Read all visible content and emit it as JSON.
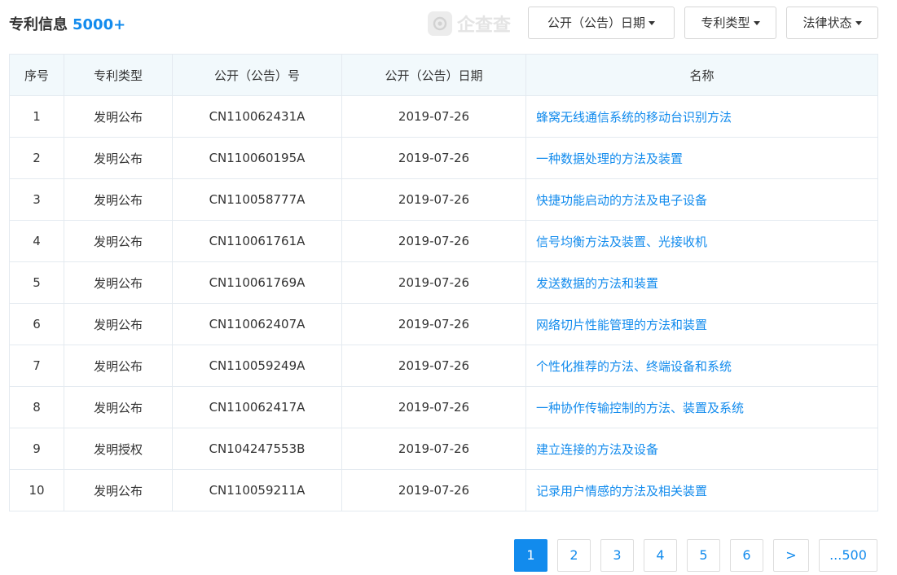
{
  "header": {
    "title": "专利信息",
    "count": "5000+",
    "watermark_text": "企查查"
  },
  "filters": [
    {
      "label": "公开（公告）日期"
    },
    {
      "label": "专利类型"
    },
    {
      "label": "法律状态"
    }
  ],
  "table": {
    "columns": [
      "序号",
      "专利类型",
      "公开（公告）号",
      "公开（公告）日期",
      "名称"
    ],
    "rows": [
      {
        "index": "1",
        "type": "发明公布",
        "number": "CN110062431A",
        "date": "2019-07-26",
        "name": "蜂窝无线通信系统的移动台识别方法"
      },
      {
        "index": "2",
        "type": "发明公布",
        "number": "CN110060195A",
        "date": "2019-07-26",
        "name": "一种数据处理的方法及装置"
      },
      {
        "index": "3",
        "type": "发明公布",
        "number": "CN110058777A",
        "date": "2019-07-26",
        "name": "快捷功能启动的方法及电子设备"
      },
      {
        "index": "4",
        "type": "发明公布",
        "number": "CN110061761A",
        "date": "2019-07-26",
        "name": "信号均衡方法及装置、光接收机"
      },
      {
        "index": "5",
        "type": "发明公布",
        "number": "CN110061769A",
        "date": "2019-07-26",
        "name": "发送数据的方法和装置"
      },
      {
        "index": "6",
        "type": "发明公布",
        "number": "CN110062407A",
        "date": "2019-07-26",
        "name": "网络切片性能管理的方法和装置"
      },
      {
        "index": "7",
        "type": "发明公布",
        "number": "CN110059249A",
        "date": "2019-07-26",
        "name": "个性化推荐的方法、终端设备和系统"
      },
      {
        "index": "8",
        "type": "发明公布",
        "number": "CN110062417A",
        "date": "2019-07-26",
        "name": "一种协作传输控制的方法、装置及系统"
      },
      {
        "index": "9",
        "type": "发明授权",
        "number": "CN104247553B",
        "date": "2019-07-26",
        "name": "建立连接的方法及设备"
      },
      {
        "index": "10",
        "type": "发明公布",
        "number": "CN110059211A",
        "date": "2019-07-26",
        "name": "记录用户情感的方法及相关装置"
      }
    ]
  },
  "pagination": {
    "pages": [
      "1",
      "2",
      "3",
      "4",
      "5",
      "6"
    ],
    "current": "1",
    "next_label": ">",
    "last_label": "...500"
  },
  "colors": {
    "accent": "#128bed",
    "header_bg": "#f2f9fc",
    "border": "#e4eaf0",
    "text": "#333333"
  }
}
